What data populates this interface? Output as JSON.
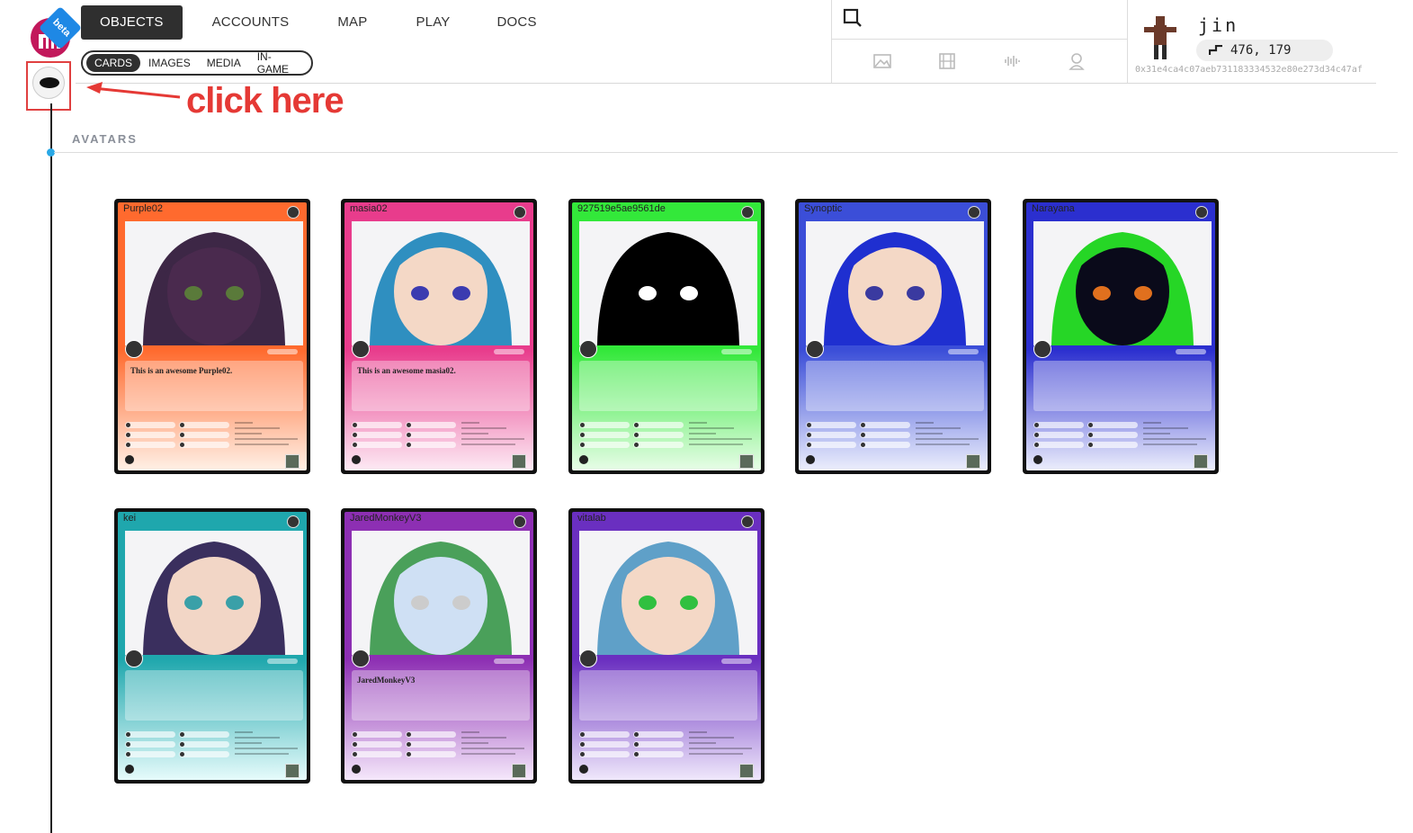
{
  "nav": {
    "beta": "beta",
    "main": [
      "OBJECTS",
      "ACCOUNTS",
      "MAP",
      "PLAY",
      "DOCS"
    ],
    "sub": [
      "CARDS",
      "IMAGES",
      "MEDIA",
      "IN-GAME"
    ]
  },
  "user": {
    "name": "jin",
    "coords": "476, 179",
    "address": "0x31e4ca4c07aeb731183334532e80e273d34c47af"
  },
  "annotation": {
    "text": "click here",
    "color": "#e53935"
  },
  "section": {
    "title": "AVATARS"
  },
  "cards": [
    {
      "name": "Purple02",
      "desc": "This is an awesome Purple02.",
      "gradient": [
        "#ff6a2e",
        "#fff0e6"
      ],
      "face": "#4a2a4e",
      "hair": "#3d2746",
      "eye": "#5a7a3a"
    },
    {
      "name": "masia02",
      "desc": "This is an awesome masia02.",
      "gradient": [
        "#e83c8c",
        "#fdeaf4"
      ],
      "face": "#f4d8c6",
      "hair": "#2f8fc0",
      "eye": "#3b3bb0"
    },
    {
      "name": "927519e5ae9561de",
      "desc": "",
      "gradient": [
        "#33e83a",
        "#e8fde8"
      ],
      "face": "#000000",
      "hair": "#000000",
      "eye": "#ffffff"
    },
    {
      "name": "Synoptic",
      "desc": "",
      "gradient": [
        "#3b4ed8",
        "#eceefc"
      ],
      "face": "#f4d8c6",
      "hair": "#1f2fd0",
      "eye": "#3a3aa0"
    },
    {
      "name": "Narayana",
      "desc": "",
      "gradient": [
        "#2b2fcf",
        "#eceefc"
      ],
      "face": "#0a0a1a",
      "hair": "#26d626",
      "eye": "#e0701e"
    },
    {
      "name": "kei",
      "desc": "",
      "gradient": [
        "#1fa7ad",
        "#e6fbfb"
      ],
      "face": "#f2d6c6",
      "hair": "#3a2f5e",
      "eye": "#3aa0a8"
    },
    {
      "name": "JaredMonkeyV3",
      "desc": "JaredMonkeyV3",
      "gradient": [
        "#8d2fb3",
        "#f5e8fb"
      ],
      "face": "#cfe0f4",
      "hair": "#4aa05a",
      "eye": "#cccccc"
    },
    {
      "name": "vitalab",
      "desc": "",
      "gradient": [
        "#6a2fc0",
        "#efe8fb"
      ],
      "face": "#f4d8c6",
      "hair": "#5fa0c8",
      "eye": "#30c040"
    }
  ]
}
